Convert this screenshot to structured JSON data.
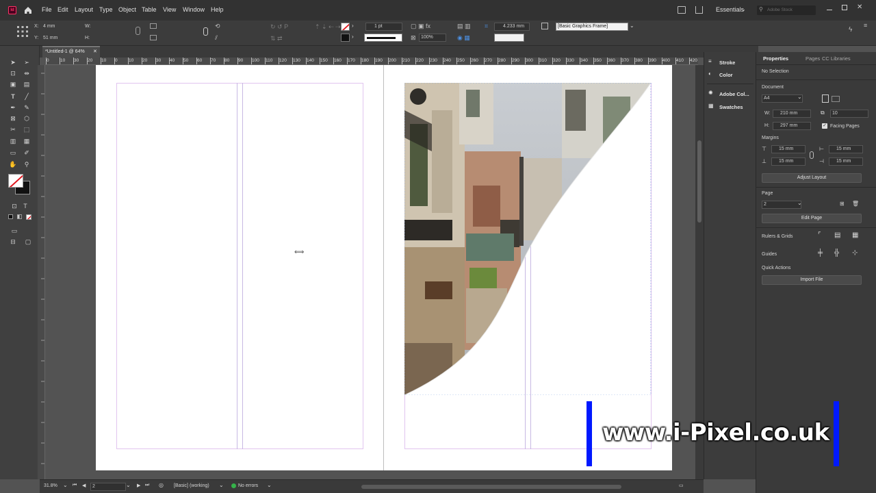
{
  "app": {
    "logo_label": "Id",
    "menu": [
      "File",
      "Edit",
      "Layout",
      "Type",
      "Object",
      "Table",
      "View",
      "Window",
      "Help"
    ],
    "workspace": "Essentials",
    "search_placeholder": "Adobe Stock"
  },
  "control_bar": {
    "x_label": "X:",
    "x_value": "4 mm",
    "y_label": "Y:",
    "y_value": "51 mm",
    "w_label": "W:",
    "h_label": "H:",
    "stroke_weight": "1 pt",
    "opacity": "100%",
    "offset_value": "4.233 mm",
    "frame_style": "[Basic Graphics Frame]"
  },
  "document": {
    "tab_title": "*Untitled-1 @ 64%",
    "ruler_ticks": [
      "0",
      "10",
      "30",
      "20",
      "10",
      "0",
      "10",
      "20",
      "30",
      "40",
      "50",
      "60",
      "70",
      "80",
      "90",
      "100",
      "110",
      "120",
      "130",
      "140",
      "150",
      "160",
      "170",
      "180",
      "190",
      "200",
      "210",
      "220",
      "230",
      "240",
      "250",
      "260",
      "270",
      "280",
      "290",
      "300",
      "310",
      "320",
      "330",
      "340",
      "350",
      "360",
      "370",
      "380",
      "390",
      "400",
      "410",
      "420",
      "430"
    ]
  },
  "status_bar": {
    "zoom": "31.8%",
    "page": "2",
    "preflight_profile": "[Basic] (working)",
    "errors": "No errors"
  },
  "dock": {
    "items": [
      "Stroke",
      "Color",
      "Adobe Col...",
      "Swatches"
    ]
  },
  "properties": {
    "tabs": [
      "Properties",
      "Pages",
      "CC Libraries"
    ],
    "selection": "No Selection",
    "document_heading": "Document",
    "preset": "A4",
    "w_label": "W:",
    "width": "210 mm",
    "h_label": "H:",
    "height": "297 mm",
    "pages_count": "10",
    "facing_pages_label": "Facing Pages",
    "margins_heading": "Margins",
    "margin_top": "15 mm",
    "margin_bottom": "15 mm",
    "margin_left": "15 mm",
    "margin_right": "15 mm",
    "adjust_layout": "Adjust Layout",
    "page_heading": "Page",
    "page_value": "2",
    "edit_page": "Edit Page",
    "rulers_grids": "Rulers & Grids",
    "guides": "Guides",
    "quick_actions": "Quick Actions",
    "import_file": "Import File"
  },
  "watermark": {
    "text": "www.i-Pixel.co.uk"
  }
}
